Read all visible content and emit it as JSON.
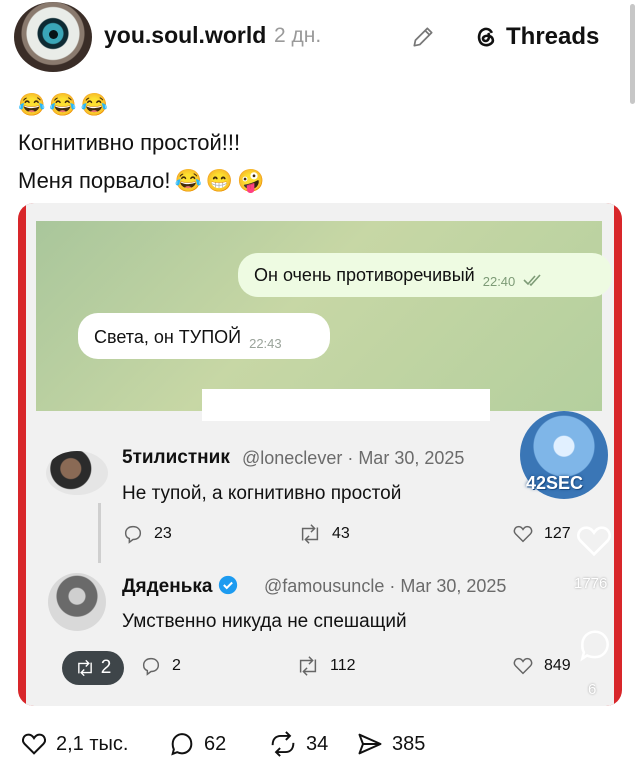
{
  "header": {
    "username": "you.soul.world",
    "time": "2 дн.",
    "threads_label": "Threads"
  },
  "post": {
    "line1_emojis": [
      "😂",
      "😂",
      "😂"
    ],
    "line2": "Когнитивно простой!!!",
    "line3_text": "Меня порвало!",
    "line3_emojis": [
      "😂",
      "😁",
      "🤪"
    ]
  },
  "media": {
    "telegram": {
      "outgoing_text": "Он очень противоречивый",
      "outgoing_time": "22:40",
      "incoming_text": "Света, он ТУПОЙ",
      "incoming_time": "22:43"
    },
    "tweet1": {
      "name": "5тилистник",
      "handle_date": "@loneclever · Mar 30, 2025",
      "text": "Не тупой, а когнитивно простой",
      "replies": "23",
      "reposts": "43",
      "likes": "127"
    },
    "tweet2": {
      "name": "Дяденька",
      "handle_date": "@famousuncle · Mar 30, 2025",
      "text": "Умственно никуда не спешащий",
      "replies": "2",
      "reposts": "112",
      "likes": "849"
    },
    "mascot_badge": "42SEC",
    "overlay_like_count": "1776",
    "overlay_comment_count": "6",
    "repost_pill_count": "2"
  },
  "actions": {
    "likes": "2,1 тыс.",
    "comments": "62",
    "reposts": "34",
    "shares": "385"
  },
  "colors": {
    "media_border": "#d8262a",
    "telegram_bg": "#b4cf9e",
    "verified": "#1d9bf0"
  }
}
